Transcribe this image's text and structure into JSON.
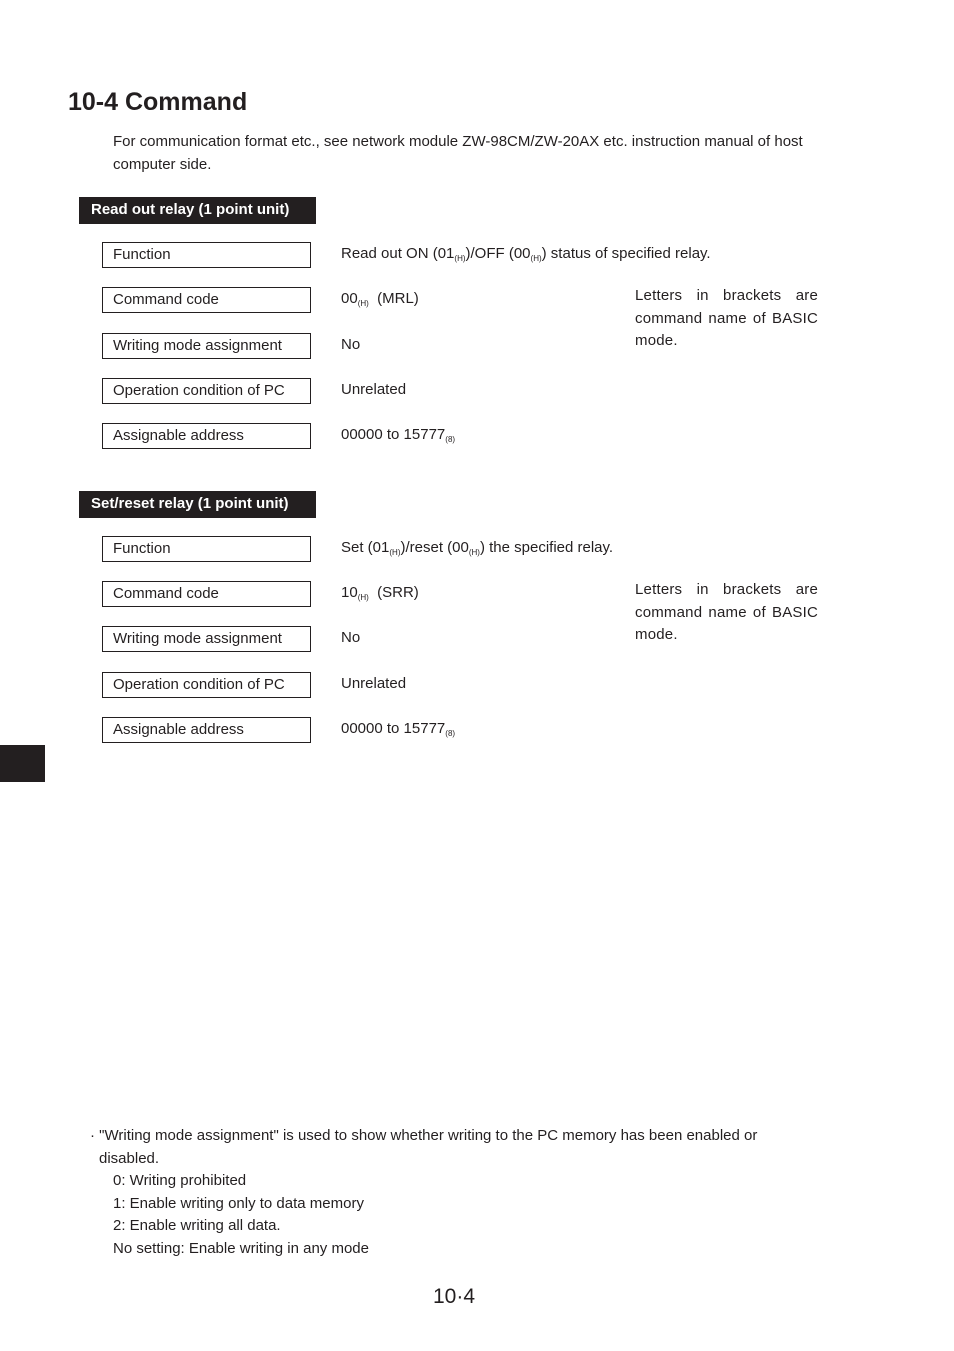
{
  "title": "10-4  Command",
  "intro": "For communication format etc., see network module ZW-98CM/ZW-20AX etc. instruction manual of host computer side.",
  "sections": [
    {
      "header": "Read out relay (1 point unit)",
      "rows": [
        {
          "label": "Function",
          "value_parts": [
            "Read out ON (01",
            "(H)",
            ")/OFF (00",
            "(H)",
            ") status of specified relay."
          ]
        },
        {
          "label": "Command code",
          "value_parts": [
            "00",
            "(H)",
            "  (MRL)"
          ]
        },
        {
          "label": "Writing mode assignment",
          "value": "No"
        },
        {
          "label": "Operation condition of PC",
          "value": "Unrelated"
        },
        {
          "label": "Assignable address",
          "value_parts": [
            "00000 to 15777",
            "(8)"
          ]
        }
      ],
      "note": "Letters in brackets are command name of BASIC mode."
    },
    {
      "header": "Set/reset relay (1 point unit)",
      "rows": [
        {
          "label": "Function",
          "value_parts": [
            "Set (01",
            "(H)",
            ")/reset (00",
            "(H)",
            ") the specified relay."
          ]
        },
        {
          "label": "Command code",
          "value_parts": [
            "10",
            "(H)",
            "  (SRR)"
          ]
        },
        {
          "label": "Writing mode assignment",
          "value": "No"
        },
        {
          "label": "Operation condition of PC",
          "value": "Unrelated"
        },
        {
          "label": "Assignable address",
          "value_parts": [
            "00000 to 15777",
            "(8)"
          ]
        }
      ],
      "note": "Letters in brackets are command name of BASIC mode."
    }
  ],
  "footnote": {
    "line1": "· \"Writing mode assignment\" is used to show whether writing to the PC memory has been enabled or",
    "line2": "disabled.",
    "items": [
      "0: Writing prohibited",
      "1: Enable writing only to data memory",
      "2: Enable writing all data.",
      "No setting: Enable writing in any mode"
    ]
  },
  "page_number": "10·4"
}
